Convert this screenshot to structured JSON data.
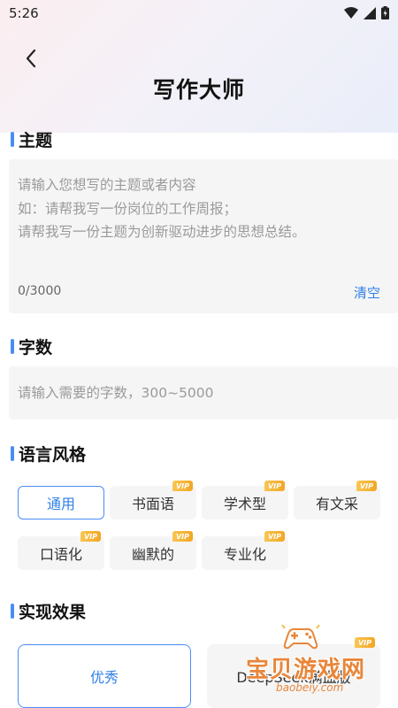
{
  "status_bar": {
    "time": "5:26"
  },
  "header": {
    "title": "写作大师"
  },
  "topic": {
    "section_title": "主题",
    "placeholder": "请输入您想写的主题或者内容\n如：请帮我写一份岗位的工作周报；\n请帮我写一份主题为创新驱动进步的思想总结。",
    "count": "0/3000",
    "clear_label": "清空"
  },
  "word_count": {
    "section_title": "字数",
    "placeholder": "请输入需要的字数，300~5000"
  },
  "style": {
    "section_title": "语言风格",
    "vip_label": "VIP",
    "options": [
      {
        "label": "通用",
        "selected": true,
        "vip": false
      },
      {
        "label": "书面语",
        "selected": false,
        "vip": true
      },
      {
        "label": "学术型",
        "selected": false,
        "vip": true
      },
      {
        "label": "有文采",
        "selected": false,
        "vip": true
      },
      {
        "label": "口语化",
        "selected": false,
        "vip": true
      },
      {
        "label": "幽默的",
        "selected": false,
        "vip": true
      },
      {
        "label": "专业化",
        "selected": false,
        "vip": true
      }
    ]
  },
  "effect": {
    "section_title": "实现效果",
    "options": [
      {
        "label": "优秀",
        "selected": true,
        "vip": false
      },
      {
        "label": "DeepSeek满血版",
        "selected": false,
        "vip": true
      }
    ]
  },
  "watermark": {
    "text": "宝贝游戏网",
    "url": "baobeiy.com"
  },
  "colors": {
    "accent": "#4a8df7",
    "link": "#2f7fe8",
    "vip": "#f2a623"
  }
}
